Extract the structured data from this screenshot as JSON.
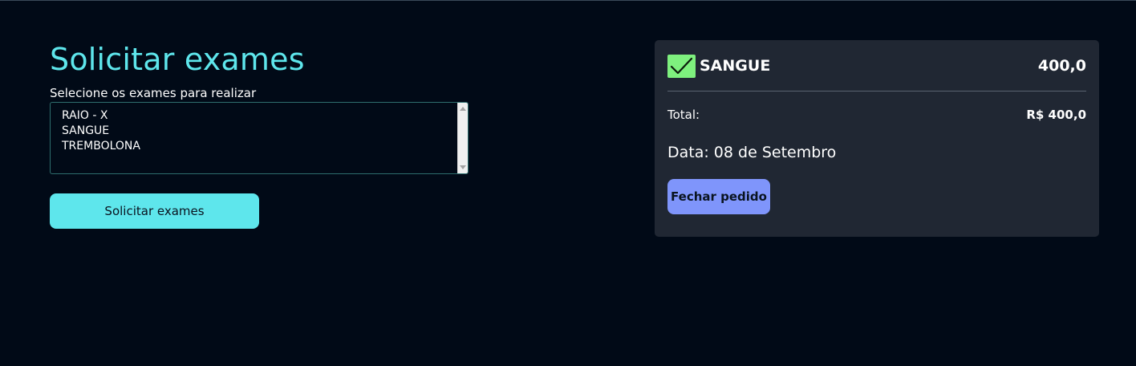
{
  "request": {
    "title": "Solicitar exames",
    "subtitle": "Selecione os exames para realizar",
    "exam_options": [
      "RAIO - X",
      "SANGUE",
      "TREMBOLONA"
    ],
    "submit_label": "Solicitar exames"
  },
  "order": {
    "item": {
      "checked": true,
      "check_icon": "check-icon",
      "name": "SANGUE",
      "price": "400,0"
    },
    "total_label": "Total:",
    "total_value": "R$ 400,0",
    "date": "Data: 08 de Setembro",
    "close_label": "Fechar pedido"
  },
  "colors": {
    "background": "#010a17",
    "accent": "#5ee6ec",
    "card": "#202733",
    "check": "#7ef07e",
    "close_button": "#7f95fb"
  }
}
